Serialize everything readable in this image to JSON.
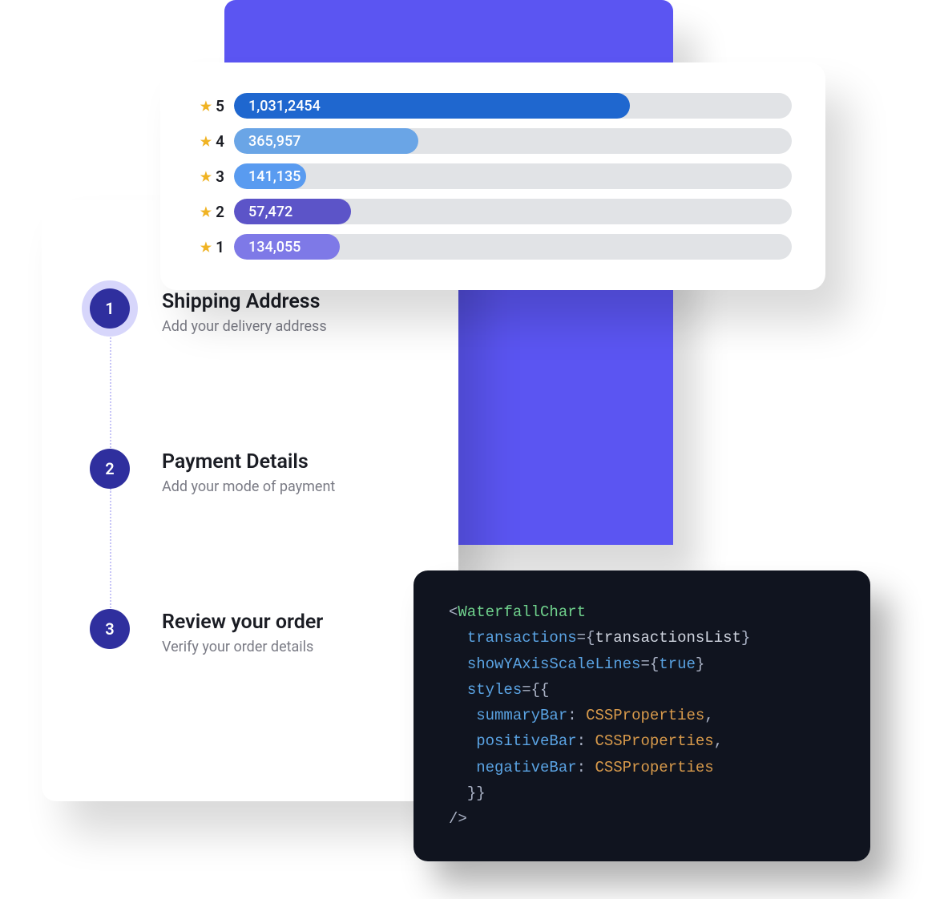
{
  "ratings": [
    {
      "stars": "5",
      "count": "1,031,2454",
      "color": "#1f67cf",
      "pct": 71
    },
    {
      "stars": "4",
      "count": "365,957",
      "color": "#6aa5e6",
      "pct": 33
    },
    {
      "stars": "3",
      "count": "141,135",
      "color": "#599bf0",
      "pct": 13
    },
    {
      "stars": "2",
      "count": "57,472",
      "color": "#5c54c8",
      "pct": 21
    },
    {
      "stars": "1",
      "count": "134,055",
      "color": "#7e79e7",
      "pct": 19
    }
  ],
  "steps": [
    {
      "num": "1",
      "title": "Shipping Address",
      "sub": "Add your delivery address",
      "active": true
    },
    {
      "num": "2",
      "title": "Payment Details",
      "sub": "Add your mode of payment",
      "active": false
    },
    {
      "num": "3",
      "title": "Review your order",
      "sub": "Verify your order details",
      "active": false
    }
  ],
  "code": {
    "tag": "WaterfallChart",
    "attr_transactions": "transactions",
    "val_transactions": "transactionsList",
    "attr_show": "showYAxisScaleLines",
    "val_show": "true",
    "attr_styles": "styles",
    "style_summary": "summaryBar",
    "style_positive": "positiveBar",
    "style_negative": "negativeBar",
    "css_type": "CSSProperties"
  },
  "chart_data": {
    "type": "bar",
    "categories": [
      "5",
      "4",
      "3",
      "2",
      "1"
    ],
    "values": [
      10312454,
      365957,
      141135,
      57472,
      134055
    ],
    "title": "",
    "xlabel": "",
    "ylabel": ""
  }
}
